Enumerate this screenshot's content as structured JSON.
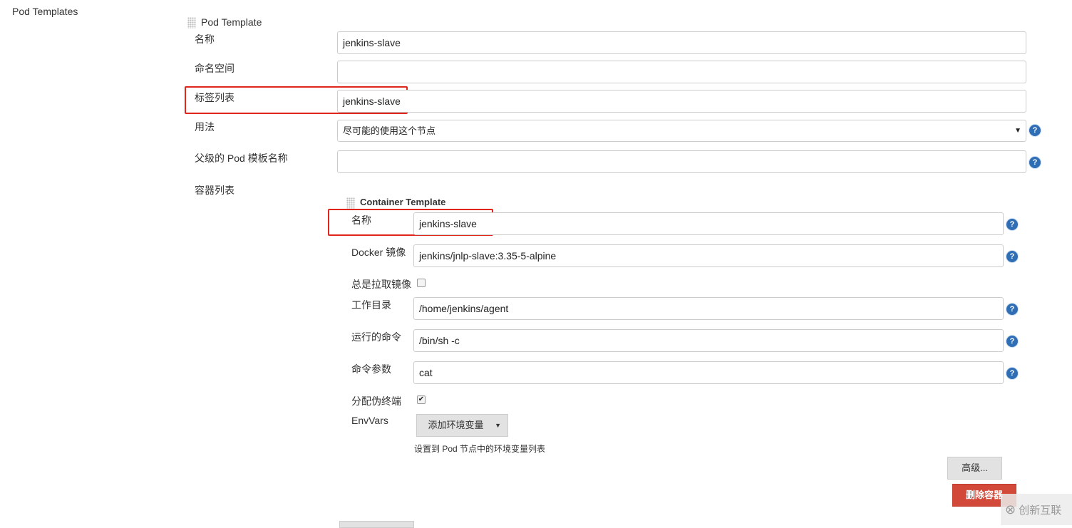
{
  "section_title": "Pod Templates",
  "pod": {
    "heading": "Pod Template",
    "name_label": "名称",
    "name_value": "jenkins-slave",
    "namespace_label": "命名空间",
    "namespace_value": "",
    "labels_label": "标签列表",
    "labels_value": "jenkins-slave",
    "usage_label": "用法",
    "usage_value": "尽可能的使用这个节点",
    "parent_label": "父级的 Pod 模板名称",
    "parent_value": "",
    "containers_label": "容器列表"
  },
  "container": {
    "heading": "Container Template",
    "name_label": "名称",
    "name_value": "jenkins-slave",
    "image_label": "Docker 镜像",
    "image_value": "jenkins/jnlp-slave:3.35-5-alpine",
    "pull_label": "总是拉取镜像",
    "pull_checked": false,
    "workdir_label": "工作目录",
    "workdir_value": "/home/jenkins/agent",
    "command_label": "运行的命令",
    "command_value": "/bin/sh -c",
    "args_label": "命令参数",
    "args_value": "cat",
    "tty_label": "分配伪终端",
    "tty_checked": true,
    "envvars_label": "EnvVars",
    "add_env_button": "添加环境变量",
    "envvars_help": "设置到 Pod 节点中的环境变量列表",
    "advanced_button": "高级...",
    "delete_button": "删除容器"
  },
  "help_glyph": "?",
  "watermark": "创新互联",
  "colors": {
    "delete": "#d24939",
    "highlight": "#e0251c",
    "help": "#2f6eb5"
  }
}
